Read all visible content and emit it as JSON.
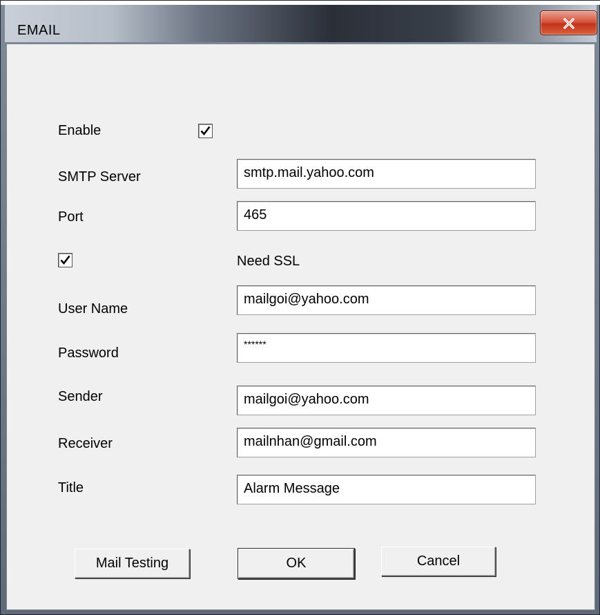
{
  "window": {
    "title": "EMAIL",
    "close_glyph": "X"
  },
  "form": {
    "enable": {
      "label": "Enable",
      "checked": true
    },
    "smtp_server": {
      "label": "SMTP Server",
      "value": "smtp.mail.yahoo.com"
    },
    "port": {
      "label": "Port",
      "value": "465"
    },
    "ssl": {
      "label": "Need SSL",
      "checked": true
    },
    "user_name": {
      "label": "User Name",
      "value": "mailgoi@yahoo.com"
    },
    "password": {
      "label": "Password",
      "value": "******"
    },
    "sender": {
      "label": "Sender",
      "value": "mailgoi@yahoo.com"
    },
    "receiver": {
      "label": "Receiver",
      "value": "mailnhan@gmail.com"
    },
    "title": {
      "label": "Title",
      "value": "Alarm Message"
    }
  },
  "buttons": {
    "mail_testing": "Mail Testing",
    "ok": "OK",
    "cancel": "Cancel"
  },
  "icons": {
    "close": "close-icon",
    "check": "checkmark-icon"
  }
}
